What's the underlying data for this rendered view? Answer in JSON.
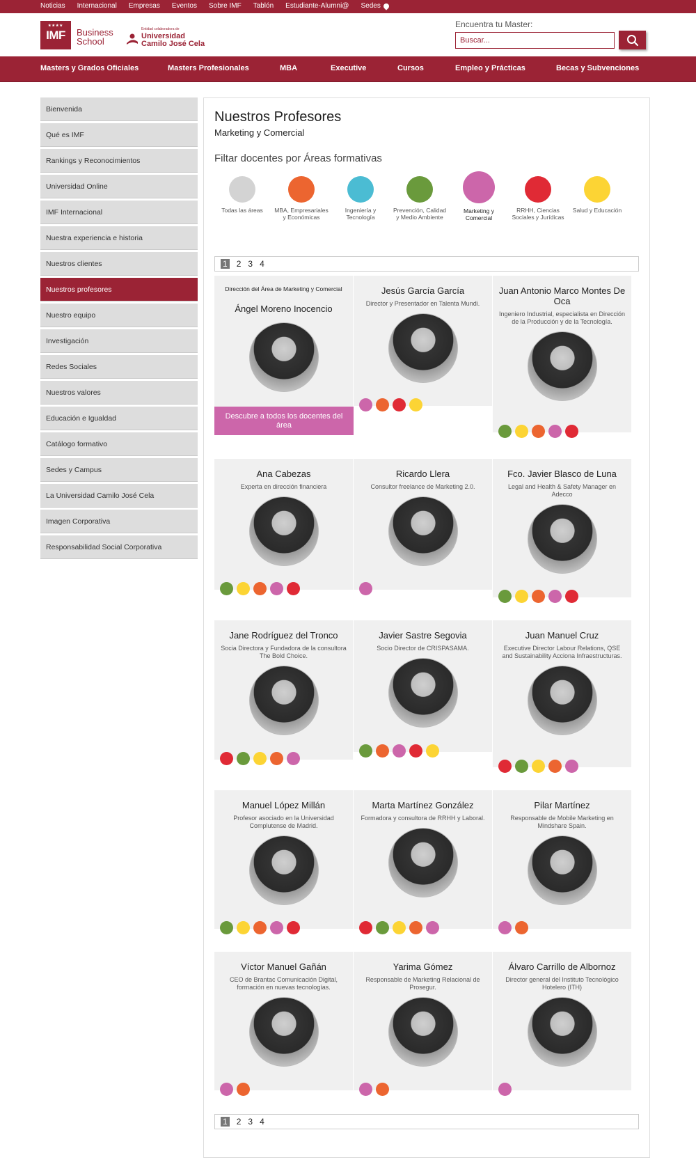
{
  "topbar": {
    "links": [
      "Noticias",
      "Internacional",
      "Empresas",
      "Eventos",
      "Sobre IMF",
      "Tablón",
      "Estudiante-Alumni@",
      "Sedes"
    ]
  },
  "header": {
    "logo": "IMF",
    "business": "Business",
    "school": "School",
    "ucjc_small": "Entidad colaboradora de",
    "ucjc_line1": "Universidad",
    "ucjc_line2": "Camilo José Cela",
    "search_label": "Encuentra tu Master:",
    "search_placeholder": "Buscar..."
  },
  "mainnav": [
    "Masters y Grados Oficiales",
    "Masters Profesionales",
    "MBA",
    "Executive",
    "Cursos",
    "Empleo y Prácticas",
    "Becas y Subvenciones"
  ],
  "sidebar": [
    "Bienvenida",
    "Qué es IMF",
    "Rankings y Reconocimientos",
    "Universidad Online",
    "IMF Internacional",
    "Nuestra experiencia e historia",
    "Nuestros clientes",
    "Nuestros profesores",
    "Nuestro equipo",
    "Investigación",
    "Redes Sociales",
    "Nuestros valores",
    "Educación e Igualdad",
    "Catálogo formativo",
    "Sedes y Campus",
    "La Universidad Camilo José Cela",
    "Imagen Corporativa",
    "Responsabilidad Social Corporativa"
  ],
  "sidebar_active": "Nuestros profesores",
  "page": {
    "title": "Nuestros Profesores",
    "subtitle": "Marketing y Comercial",
    "filter_title": "Filtar docentes por Áreas formativas"
  },
  "colors": {
    "brand": "#9b2335",
    "gray": "#d3d3d3",
    "orange": "#ec6530",
    "cyan": "#4bbcd3",
    "green": "#6a9a3c",
    "pink": "#cc66aa",
    "red": "#e02a35",
    "yellow": "#fcd434"
  },
  "areas": [
    {
      "label": "Todas las áreas",
      "color": "gray"
    },
    {
      "label": "MBA, Empresariales y Económicas",
      "color": "orange"
    },
    {
      "label": "Ingeniería y Tecnología",
      "color": "cyan"
    },
    {
      "label": "Prevención, Calidad y Medio Ambiente",
      "color": "green"
    },
    {
      "label": "Marketing y Comercial",
      "color": "pink",
      "selected": true
    },
    {
      "label": "RRHH, Ciencias Sociales y Jurídicas",
      "color": "red"
    },
    {
      "label": "Salud y Educación",
      "color": "yellow"
    }
  ],
  "pagination": {
    "pages": [
      "1",
      "2",
      "3",
      "4"
    ],
    "current": "1"
  },
  "director": {
    "heading": "Dirección del Área de Marketing y Comercial",
    "name": "Ángel Moreno Inocencio",
    "cta": "Descubre a todos los docentes del área"
  },
  "professors": [
    {
      "name": "Jesús García García",
      "role": "Director y Presentador en Talenta Mundi.",
      "dots": [
        "pink",
        "orange",
        "red",
        "yellow"
      ]
    },
    {
      "name": "Juan Antonio Marco Montes De Oca",
      "role": "Ingeniero Industrial, especialista en Dirección de la Producción y de la Tecnología.",
      "dots": [
        "green",
        "yellow",
        "orange",
        "pink",
        "red"
      ]
    },
    {
      "name": "Ana Cabezas",
      "role": "Experta en dirección financiera",
      "dots": [
        "green",
        "yellow",
        "orange",
        "pink",
        "red"
      ]
    },
    {
      "name": "Ricardo Llera",
      "role": "Consultor freelance de Marketing 2.0.",
      "dots": [
        "pink"
      ]
    },
    {
      "name": "Fco. Javier Blasco de Luna",
      "role": "Legal and Health & Safety Manager en Adecco",
      "dots": [
        "green",
        "yellow",
        "orange",
        "pink",
        "red"
      ]
    },
    {
      "name": "Jane Rodríguez del Tronco",
      "role": "Socia Directora y Fundadora de la consultora The Bold Choice.",
      "dots": [
        "red",
        "green",
        "yellow",
        "orange",
        "pink"
      ]
    },
    {
      "name": "Javier Sastre Segovia",
      "role": "Socio Director de CRISPASAMA.",
      "dots": [
        "green",
        "orange",
        "pink",
        "red",
        "yellow"
      ]
    },
    {
      "name": "Juan Manuel Cruz",
      "role": "Executive Director Labour Relations, QSE and Sustainability Acciona Infraestructuras.",
      "dots": [
        "red",
        "green",
        "yellow",
        "orange",
        "pink"
      ]
    },
    {
      "name": "Manuel López Millán",
      "role": "Profesor asociado en la Universidad Complutense de Madrid.",
      "dots": [
        "green",
        "yellow",
        "orange",
        "pink",
        "red"
      ]
    },
    {
      "name": "Marta Martínez González",
      "role": "Formadora y consultora de RRHH y Laboral.",
      "dots": [
        "red",
        "green",
        "yellow",
        "orange",
        "pink"
      ]
    },
    {
      "name": "Pilar Martínez",
      "role": "Responsable de Mobile Marketing en Mindshare Spain.",
      "dots": [
        "pink",
        "orange"
      ]
    },
    {
      "name": "Víctor Manuel Gañán",
      "role": "CEO de Brantac Comunicación Digital, formación en nuevas tecnologías.",
      "dots": [
        "pink",
        "orange"
      ]
    },
    {
      "name": "Yarima Gómez",
      "role": "Responsable de Marketing Relacional de Prosegur.",
      "dots": [
        "pink",
        "orange"
      ]
    },
    {
      "name": "Álvaro Carrillo de Albornoz",
      "role": "Director general del Instituto Tecnológico Hotelero (ITH)",
      "dots": [
        "pink"
      ]
    }
  ]
}
